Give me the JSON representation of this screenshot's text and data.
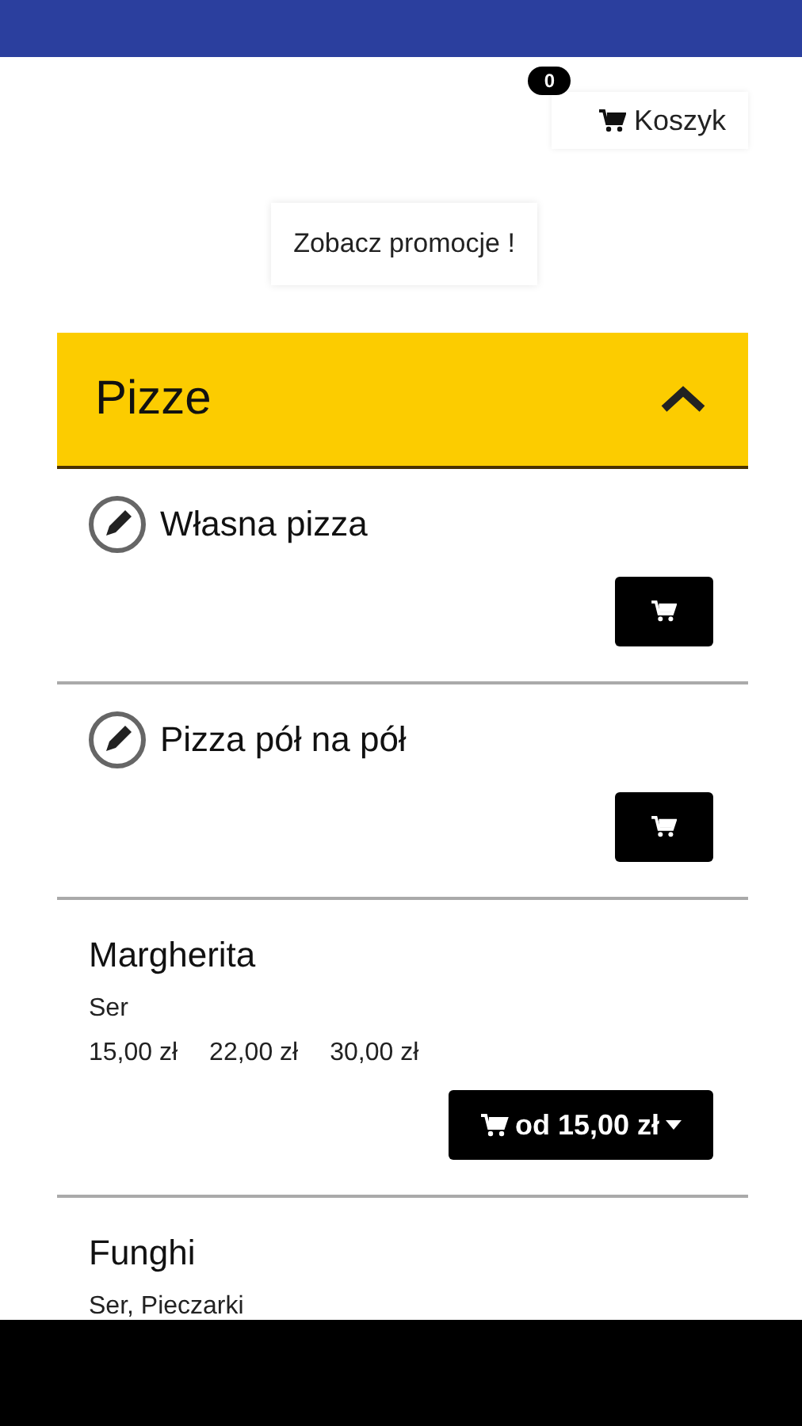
{
  "cart": {
    "count": "0",
    "label": "Koszyk"
  },
  "promo_button": "Zobacz promocje !",
  "category": {
    "title": "Pizze",
    "expanded": true
  },
  "items": [
    {
      "kind": "custom",
      "name": "Własna pizza"
    },
    {
      "kind": "custom",
      "name": "Pizza pół na pół"
    },
    {
      "kind": "product",
      "name": "Margherita",
      "ingredients": "Ser",
      "prices": [
        "15,00 zł",
        "22,00 zł",
        "30,00 zł"
      ],
      "button": "od 15,00 zł"
    },
    {
      "kind": "product",
      "name": "Funghi",
      "ingredients": "Ser, Pieczarki"
    }
  ]
}
